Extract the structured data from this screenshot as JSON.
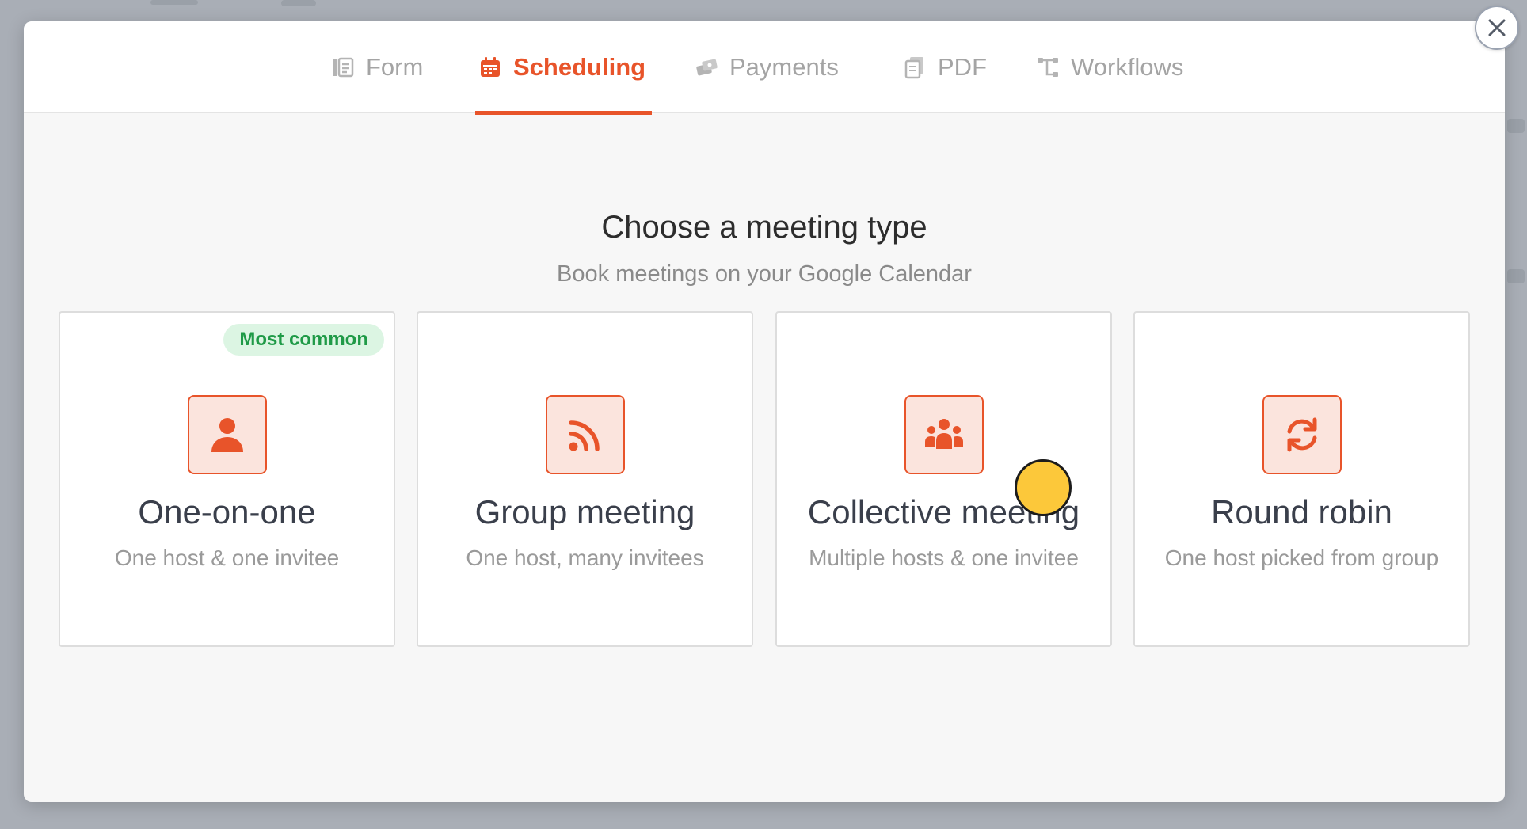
{
  "tabs": [
    {
      "label": "Form",
      "icon": "form-icon",
      "active": false
    },
    {
      "label": "Scheduling",
      "icon": "calendar-icon",
      "active": true
    },
    {
      "label": "Payments",
      "icon": "payments-icon",
      "active": false
    },
    {
      "label": "PDF",
      "icon": "pdf-icon",
      "active": false
    },
    {
      "label": "Workflows",
      "icon": "workflows-icon",
      "active": false
    }
  ],
  "main": {
    "heading": "Choose a meeting type",
    "subheading": "Book meetings on your Google Calendar"
  },
  "cards": [
    {
      "title": "One-on-one",
      "description": "One host & one invitee",
      "badge": "Most common",
      "icon": "person-icon"
    },
    {
      "title": "Group meeting",
      "description": "One host, many invitees",
      "icon": "broadcast-icon"
    },
    {
      "title": "Collective meeting",
      "description": "Multiple hosts & one invitee",
      "icon": "people-group-icon"
    },
    {
      "title": "Round robin",
      "description": "One host picked from group",
      "icon": "rotate-arrows-icon"
    }
  ],
  "colors": {
    "accent": "#e8542a",
    "accent_bg": "#fbe4dd",
    "badge_bg": "#dcf5e3",
    "badge_text": "#1f9a47",
    "cursor": "#fcc83a"
  },
  "close_icon": "close-icon"
}
